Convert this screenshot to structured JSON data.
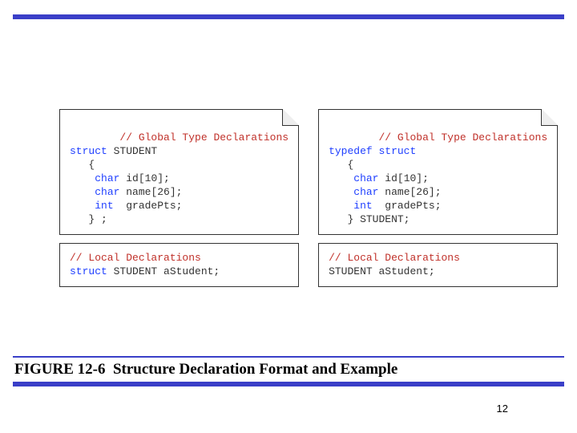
{
  "slide": {
    "page_number": "12"
  },
  "caption": {
    "figure_label": "FIGURE 12-6",
    "figure_title": "Structure Declaration Format and Example"
  },
  "code_left": {
    "top": {
      "l1_comment": "// Global Type Declarations",
      "l2_kw": "struct",
      "l2_rest": " STUDENT",
      "l3": "   {",
      "l4_pre": "    ",
      "l4_kw": "char",
      "l4_rest": " id[10];",
      "l5_pre": "    ",
      "l5_kw": "char",
      "l5_rest": " name[26];",
      "l6_pre": "    ",
      "l6_kw": "int",
      "l6_rest": "  gradePts;",
      "l7": "   } ;"
    },
    "bottom": {
      "l1_comment": "// Local Declarations",
      "l2_kw": "struct",
      "l2_rest": " STUDENT aStudent;"
    }
  },
  "code_right": {
    "top": {
      "l1_comment": "// Global Type Declarations",
      "l2_kw": "typedef struct",
      "l3": "   {",
      "l4_pre": "    ",
      "l4_kw": "char",
      "l4_rest": " id[10];",
      "l5_pre": "    ",
      "l5_kw": "char",
      "l5_rest": " name[26];",
      "l6_pre": "    ",
      "l6_kw": "int",
      "l6_rest": "  gradePts;",
      "l7": "   } STUDENT;"
    },
    "bottom": {
      "l1_comment": "// Local Declarations",
      "l2": "STUDENT aStudent;"
    }
  }
}
